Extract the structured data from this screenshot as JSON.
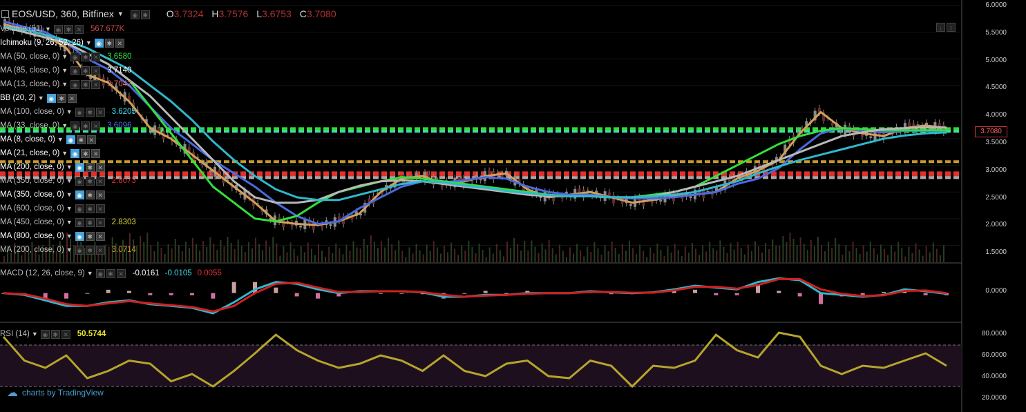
{
  "header": {
    "symbol": "EOS/USD, 360, Bitfinex",
    "o_label": "O",
    "o_value": "3.7324",
    "h_label": "H",
    "h_value": "3.7576",
    "l_label": "L",
    "l_value": "3.6753",
    "c_label": "C",
    "c_value": "3.7080"
  },
  "indicators": [
    {
      "label": "Volume (51)",
      "value": "567.677K",
      "color": "#d05050",
      "bright": false
    },
    {
      "label": "Ichimoku (9, 26, 52, 26)",
      "value": "",
      "color": "#fff",
      "bright": true
    },
    {
      "label": "MA (50, close, 0)",
      "value": "3.6580",
      "color": "#32e03c",
      "bright": false
    },
    {
      "label": "MA (85, close, 0)",
      "value": "3.7140",
      "color": "#ffffff",
      "bright": false
    },
    {
      "label": "MA (13, close, 0)",
      "value": "3.7042",
      "color": "#e07070",
      "bright": false
    },
    {
      "label": "BB (20, 2)",
      "value": "",
      "color": "#fff",
      "bright": true
    },
    {
      "label": "MA (100, close, 0)",
      "value": "3.6205",
      "color": "#40d8e8",
      "bright": false
    },
    {
      "label": "MA (33, close, 0)",
      "value": "3.6096",
      "color": "#4a6adf",
      "bright": false
    },
    {
      "label": "MA (8, close, 0)",
      "value": "",
      "color": "#fff",
      "bright": true
    },
    {
      "label": "MA (21, close, 0)",
      "value": "",
      "color": "#fff",
      "bright": true
    },
    {
      "label": "MA (200, close, 0)",
      "value": "",
      "color": "#fff",
      "bright": true
    },
    {
      "label": "MA (350, close, 0)",
      "value": "2.8073",
      "color": "#e03030",
      "bright": false
    },
    {
      "label": "MA (350, close, 0)",
      "value": "",
      "color": "#fff",
      "bright": true
    },
    {
      "label": "MA (600, close, 0)",
      "value": "",
      "color": "#fff",
      "bright": false
    },
    {
      "label": "MA (450, close, 0)",
      "value": "2.8303",
      "color": "#d8d830",
      "bright": false
    },
    {
      "label": "MA (800, close, 0)",
      "value": "",
      "color": "#fff",
      "bright": true
    },
    {
      "label": "MA (200, close, 0)",
      "value": "3.0714",
      "color": "#c89a2a",
      "bright": false
    }
  ],
  "macd_legend": {
    "label": "MACD (12, 26, close, 9)",
    "v1": "-0.0161",
    "v2": "-0.0105",
    "v3": "0.0055",
    "c1": "#ffffff",
    "c2": "#40d8e8",
    "c3": "#e03030"
  },
  "rsi_legend": {
    "label": "RSI (14)",
    "value": "50.5744",
    "color": "#e8e830"
  },
  "price_axis": [
    "6.0000",
    "5.5000",
    "5.0000",
    "4.5000",
    "4.0000",
    "3.5000",
    "3.0000",
    "2.5000",
    "2.0000",
    "1.5000"
  ],
  "macd_axis": [
    "0.0000"
  ],
  "rsi_axis": [
    "80.0000",
    "60.0000",
    "40.0000",
    "20.0000"
  ],
  "last_price": "3.7080",
  "watermark": "charts by TradingView",
  "chart_data": {
    "type": "line",
    "title": "EOS/USD, 360, Bitfinex",
    "price_ylim": [
      1.35,
      6.0
    ],
    "horizontal_levels": [
      {
        "value": 3.69,
        "color": "#2ee02e"
      },
      {
        "value": 3.64,
        "color": "#40e0a0"
      },
      {
        "value": 3.07,
        "color": "#c89a2a"
      },
      {
        "value": 2.86,
        "color": "#e03030"
      },
      {
        "value": 2.82,
        "color": "#e03030"
      },
      {
        "value": 2.77,
        "color": "#aaaaaa"
      }
    ],
    "price_series": [
      {
        "name": "MA (13, close, 0)",
        "color": "#d2a05a",
        "values": [
          5.65,
          5.55,
          5.45,
          5.2,
          4.7,
          4.55,
          4.2,
          3.7,
          3.5,
          3.2,
          2.9,
          2.6,
          2.3,
          1.95,
          1.9,
          1.88,
          1.95,
          2.1,
          2.5,
          2.75,
          2.8,
          2.65,
          2.7,
          2.8,
          2.85,
          2.55,
          2.4,
          2.45,
          2.5,
          2.4,
          2.3,
          2.35,
          2.42,
          2.45,
          2.5,
          2.75,
          2.9,
          3.1,
          3.6,
          4.0,
          3.7,
          3.6,
          3.55,
          3.7,
          3.75,
          3.7
        ]
      },
      {
        "name": "MA (33, close, 0)",
        "color": "#4a6adf",
        "values": [
          5.7,
          5.6,
          5.5,
          5.3,
          5.0,
          4.8,
          4.5,
          4.1,
          3.7,
          3.4,
          3.1,
          2.85,
          2.6,
          2.3,
          2.05,
          1.9,
          1.95,
          2.2,
          2.4,
          2.6,
          2.7,
          2.68,
          2.72,
          2.78,
          2.75,
          2.6,
          2.5,
          2.45,
          2.45,
          2.4,
          2.38,
          2.38,
          2.4,
          2.45,
          2.5,
          2.65,
          2.75,
          2.95,
          3.3,
          3.6,
          3.7,
          3.65,
          3.62,
          3.65,
          3.65,
          3.61
        ]
      },
      {
        "name": "MA (50, close, 0)",
        "color": "#32e03c",
        "values": [
          5.6,
          5.5,
          5.4,
          5.3,
          5.1,
          4.9,
          4.6,
          4.1,
          3.6,
          3.1,
          2.6,
          2.3,
          2.0,
          1.95,
          2.05,
          2.3,
          2.5,
          2.6,
          2.7,
          2.78,
          2.75,
          2.7,
          2.65,
          2.6,
          2.55,
          2.5,
          2.45,
          2.42,
          2.42,
          2.4,
          2.4,
          2.45,
          2.5,
          2.6,
          2.8,
          3.0,
          3.2,
          3.4,
          3.55,
          3.65,
          3.7,
          3.68,
          3.66,
          3.66,
          3.66,
          3.66
        ]
      },
      {
        "name": "MA (85, close, 0)",
        "color": "#b8b8b8",
        "values": [
          5.6,
          5.5,
          5.4,
          5.3,
          5.1,
          4.9,
          4.6,
          4.3,
          3.9,
          3.5,
          3.1,
          2.7,
          2.4,
          2.3,
          2.3,
          2.35,
          2.5,
          2.62,
          2.7,
          2.72,
          2.7,
          2.65,
          2.6,
          2.55,
          2.5,
          2.45,
          2.42,
          2.42,
          2.42,
          2.4,
          2.4,
          2.42,
          2.5,
          2.6,
          2.7,
          2.8,
          2.95,
          3.1,
          3.25,
          3.4,
          3.55,
          3.62,
          3.68,
          3.7,
          3.71,
          3.71
        ]
      },
      {
        "name": "MA (100, close, 0)",
        "color": "#2fb8cc",
        "values": [
          5.6,
          5.55,
          5.45,
          5.35,
          5.2,
          5.0,
          4.8,
          4.5,
          4.2,
          3.85,
          3.45,
          3.1,
          2.8,
          2.55,
          2.4,
          2.35,
          2.35,
          2.45,
          2.55,
          2.65,
          2.7,
          2.68,
          2.62,
          2.58,
          2.52,
          2.48,
          2.44,
          2.42,
          2.42,
          2.4,
          2.4,
          2.42,
          2.45,
          2.5,
          2.6,
          2.7,
          2.85,
          2.98,
          3.1,
          3.2,
          3.3,
          3.4,
          3.5,
          3.56,
          3.6,
          3.62
        ]
      }
    ],
    "macd_ylim": [
      -0.7,
      0.5
    ],
    "macd_series": [
      {
        "name": "MACD",
        "color": "#2fb8cc",
        "values": [
          0.0,
          -0.05,
          -0.2,
          -0.35,
          -0.35,
          -0.25,
          -0.2,
          -0.3,
          -0.35,
          -0.4,
          -0.55,
          -0.25,
          0.1,
          0.3,
          0.25,
          0.1,
          0.0,
          0.05,
          0.05,
          0.05,
          0.02,
          -0.1,
          -0.1,
          -0.05,
          -0.05,
          0.0,
          0.0,
          0.0,
          0.05,
          0.02,
          0.0,
          0.02,
          0.1,
          0.2,
          0.15,
          0.1,
          0.3,
          0.4,
          0.35,
          0.0,
          -0.05,
          -0.1,
          -0.05,
          0.1,
          0.05,
          -0.02
        ]
      },
      {
        "name": "Signal",
        "color": "#d02020",
        "values": [
          0.0,
          -0.03,
          -0.15,
          -0.3,
          -0.35,
          -0.28,
          -0.22,
          -0.28,
          -0.33,
          -0.38,
          -0.5,
          -0.35,
          0.0,
          0.25,
          0.28,
          0.15,
          0.03,
          0.03,
          0.05,
          0.05,
          0.03,
          -0.05,
          -0.1,
          -0.07,
          -0.05,
          -0.02,
          0.0,
          0.0,
          0.03,
          0.03,
          0.01,
          0.01,
          0.07,
          0.17,
          0.17,
          0.12,
          0.22,
          0.38,
          0.38,
          0.1,
          -0.02,
          -0.08,
          -0.06,
          0.06,
          0.07,
          0.0
        ]
      }
    ],
    "rsi_ylim": [
      10,
      90
    ],
    "rsi_levels": [
      70,
      30
    ],
    "rsi_series": {
      "name": "RSI",
      "color": "#b5a52c",
      "values": [
        78,
        55,
        48,
        60,
        38,
        45,
        55,
        52,
        35,
        42,
        30,
        45,
        62,
        80,
        65,
        55,
        48,
        52,
        60,
        55,
        45,
        60,
        45,
        40,
        52,
        55,
        40,
        38,
        55,
        50,
        30,
        50,
        48,
        55,
        80,
        65,
        58,
        82,
        78,
        50,
        42,
        50,
        48,
        55,
        62,
        50
      ]
    }
  }
}
